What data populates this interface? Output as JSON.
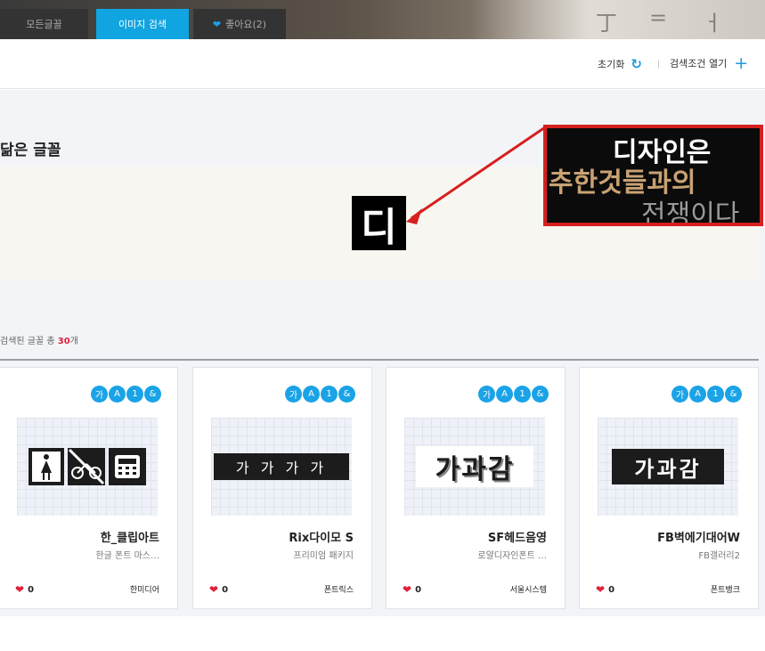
{
  "tabs": [
    {
      "label": "모든글꼴",
      "active": false
    },
    {
      "label": "이미지 검색",
      "active": true
    },
    {
      "label": "좋아요(2)",
      "active": false,
      "icon": "heart-icon"
    }
  ],
  "toolbar": {
    "reset_label": "초기화",
    "reset_icon": "refresh-icon",
    "open_conditions_label": "검색조건 열기",
    "open_conditions_icon": "plus-icon"
  },
  "section": {
    "title": "닮은 글꼴",
    "query_glyph": "디"
  },
  "sample_image": {
    "lines": [
      "디자인은",
      "추한것들과의",
      "전쟁이다"
    ],
    "border_color": "#d6201f"
  },
  "results": {
    "prefix": "검색된 글꼴 총 ",
    "count": "30",
    "suffix": "개"
  },
  "badges": [
    "가",
    "A",
    "1",
    "&"
  ],
  "cards": [
    {
      "name": "한_클립아트",
      "subtitle": "한글 폰트 마스…",
      "likes": "0",
      "maker": "한미디어",
      "preview": "clipart"
    },
    {
      "name": "Rix다이모 S",
      "subtitle": "프리미엄 패키지",
      "likes": "0",
      "maker": "폰트릭스",
      "preview": "가 가 가 가"
    },
    {
      "name": "SF헤드음영",
      "subtitle": "로얄디자인폰트 …",
      "likes": "0",
      "maker": "서울시스템",
      "preview": "가과감"
    },
    {
      "name": "FB벽에기대어W",
      "subtitle": "FB갤러리2",
      "likes": "0",
      "maker": "폰트뱅크",
      "preview": "가과감"
    }
  ],
  "colors": {
    "accent": "#10a4e0",
    "heart": "#e0203a",
    "highlight": "#d6201f"
  }
}
